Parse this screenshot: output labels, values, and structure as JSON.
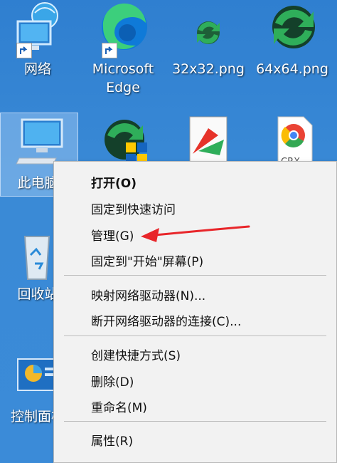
{
  "desktop": {
    "icons": [
      {
        "label": "网络",
        "icon": "network-icon"
      },
      {
        "label": "Microsoft Edge",
        "icon": "edge-icon"
      },
      {
        "label": "32x32.png",
        "icon": "png-file-icon"
      },
      {
        "label": "64x64.png",
        "icon": "png-file-icon"
      },
      {
        "label": "此电脑",
        "icon": "this-pc-icon"
      },
      {
        "label": "回收站",
        "icon": "recycle-bin-icon"
      },
      {
        "label": "控制面板",
        "icon": "control-panel-icon"
      }
    ],
    "partial_file_label": "CRX"
  },
  "context_menu": {
    "groups": [
      [
        {
          "label": "打开(O)",
          "bold": true
        },
        {
          "label": "固定到快速访问"
        },
        {
          "label": "管理(G)",
          "highlighted_by_arrow": true
        },
        {
          "label": "固定到\"开始\"屏幕(P)"
        }
      ],
      [
        {
          "label": "映射网络驱动器(N)..."
        },
        {
          "label": "断开网络驱动器的连接(C)..."
        }
      ],
      [
        {
          "label": "创建快捷方式(S)"
        },
        {
          "label": "删除(D)"
        },
        {
          "label": "重命名(M)"
        }
      ],
      [
        {
          "label": "属性(R)"
        }
      ]
    ]
  },
  "colors": {
    "desktop": "#3b8bd8",
    "menu_bg": "#f2f2f2",
    "arrow": "#e8262a"
  }
}
